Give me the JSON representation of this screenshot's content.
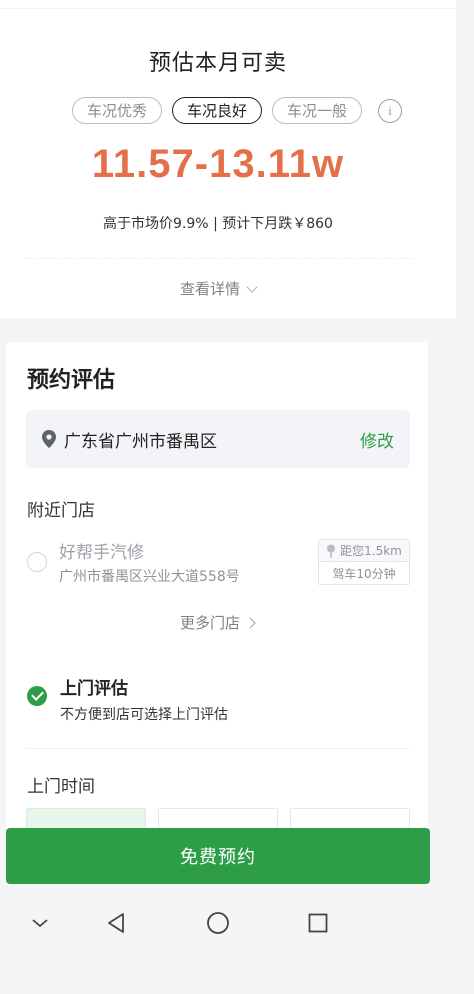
{
  "estimate": {
    "title": "预估本月可卖",
    "conditions": [
      "车况优秀",
      "车况良好",
      "车况一般"
    ],
    "selected_condition": "车况良好",
    "price_range": "11.57-13.11w",
    "price_note": "高于市场价9.9% | 预计下月跌￥860",
    "details_label": "查看详情",
    "info_glyph": "i"
  },
  "booking": {
    "title": "预约评估",
    "location": "广东省广州市番禺区",
    "edit_label": "修改",
    "nearby_label": "附近门店",
    "store": {
      "name": "好帮手汽修",
      "address": "广州市番禺区兴业大道558号",
      "distance": "距您1.5km",
      "drive_time": "驾车10分钟"
    },
    "more_stores_label": "更多门店",
    "home_visit": {
      "title": "上门评估",
      "subtitle": "不方便到店可选择上门评估",
      "checked": true
    },
    "time_label": "上门时间"
  },
  "cta_label": "免费预约",
  "colors": {
    "accent_green": "#2e9d48",
    "price_orange": "#e4704a"
  },
  "nav_icons": [
    "chevron-down-icon",
    "back-triangle-icon",
    "home-circle-icon",
    "recents-square-icon"
  ]
}
